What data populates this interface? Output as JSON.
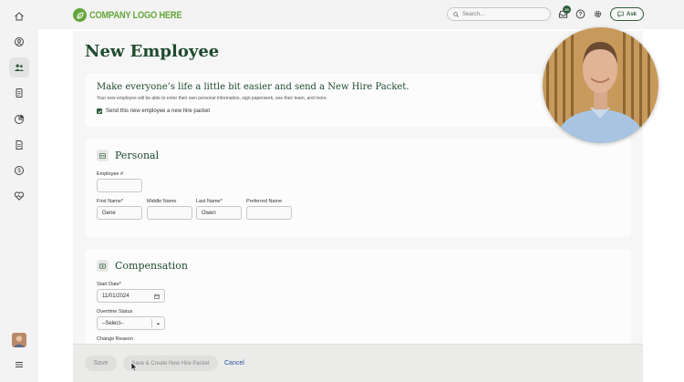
{
  "topbar": {
    "logo_text": "COMPANY LOGO HERE",
    "search_placeholder": "Search...",
    "notification_count": "20",
    "ask_label": "Ask"
  },
  "page": {
    "title": "New Employee"
  },
  "promo": {
    "title": "Make everyone’s life a little bit easier and send a New Hire Packet.",
    "subtitle": "Your new employee will be able to enter their own personal information, sign paperwork, see their team, and more.",
    "checkbox_label": "Send this new employee a new hire packet",
    "checkbox_checked": true
  },
  "personal": {
    "title": "Personal",
    "employee_number_label": "Employee #",
    "employee_number_value": "",
    "first_name_label": "First Name*",
    "first_name_value": "Gene",
    "middle_name_label": "Middle Name",
    "middle_name_value": "",
    "last_name_label": "Last Name*",
    "last_name_value": "Owen",
    "preferred_name_label": "Preferred Name",
    "preferred_name_value": ""
  },
  "compensation": {
    "title": "Compensation",
    "start_date_label": "Start Date*",
    "start_date_value": "11/01/2024",
    "overtime_label": "Overtime Status",
    "overtime_value": "–Select–",
    "change_reason_label": "Change Reason"
  },
  "footer": {
    "save_label": "Save",
    "save_create_label": "Save & Create New Hire Packet",
    "cancel_label": "Cancel"
  },
  "colors": {
    "brand_green": "#66a63c",
    "dark_green": "#1f4a2e",
    "link_blue": "#2a4f9c"
  },
  "icons": {
    "sidebar": [
      "home-icon",
      "user-circle-icon",
      "people-icon",
      "id-badge-icon",
      "pie-chart-icon",
      "document-icon",
      "dollar-icon",
      "heart-pulse-icon",
      "menu-icon"
    ],
    "topbar": [
      "search-icon",
      "inbox-icon",
      "help-icon",
      "gear-icon",
      "chat-icon"
    ]
  }
}
